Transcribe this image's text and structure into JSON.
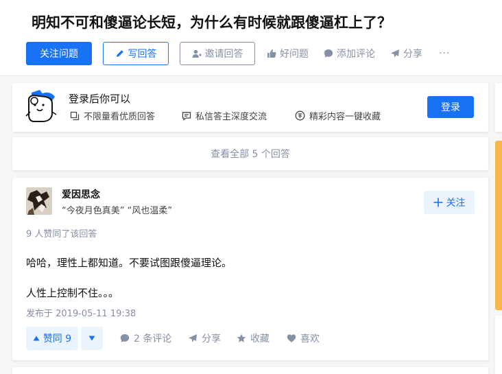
{
  "question": {
    "title": "明知不可和傻逼论长短，为什么有时候就跟傻逼杠上了？"
  },
  "question_actions": {
    "follow_label": "关注问题",
    "write_label": "写回答",
    "invite_label": "邀请回答",
    "good_label": "好问题",
    "comment_label": "添加评论",
    "share_label": "分享",
    "more_label": "···"
  },
  "login_prompt": {
    "title": "登录后你可以",
    "perks": [
      "不限量看优质回答",
      "私信答主深度交流",
      "精彩内容一键收藏"
    ],
    "login_label": "登录"
  },
  "view_all": {
    "label": "查看全部 5 个回答"
  },
  "answer": {
    "author_name": "爱因思念",
    "author_bio": "“今夜月色真美” “风也温柔”",
    "follow_label": "关注",
    "votes_text": "9 人赞同了该回答",
    "paragraphs": [
      "哈哈，理性上都知道。不要试图跟傻逼理论。",
      "人性上控制不住。。。"
    ],
    "publish_time": "发布于 2019-05-11 19:38",
    "upvote_label": "赞同 9",
    "comment_label": "2 条评论",
    "share_label": "分享",
    "collect_label": "收藏",
    "like_label": "喜欢"
  },
  "colors": {
    "brand": "#1772f6",
    "muted": "#8590a6",
    "accent_side": "#f7b84b"
  }
}
